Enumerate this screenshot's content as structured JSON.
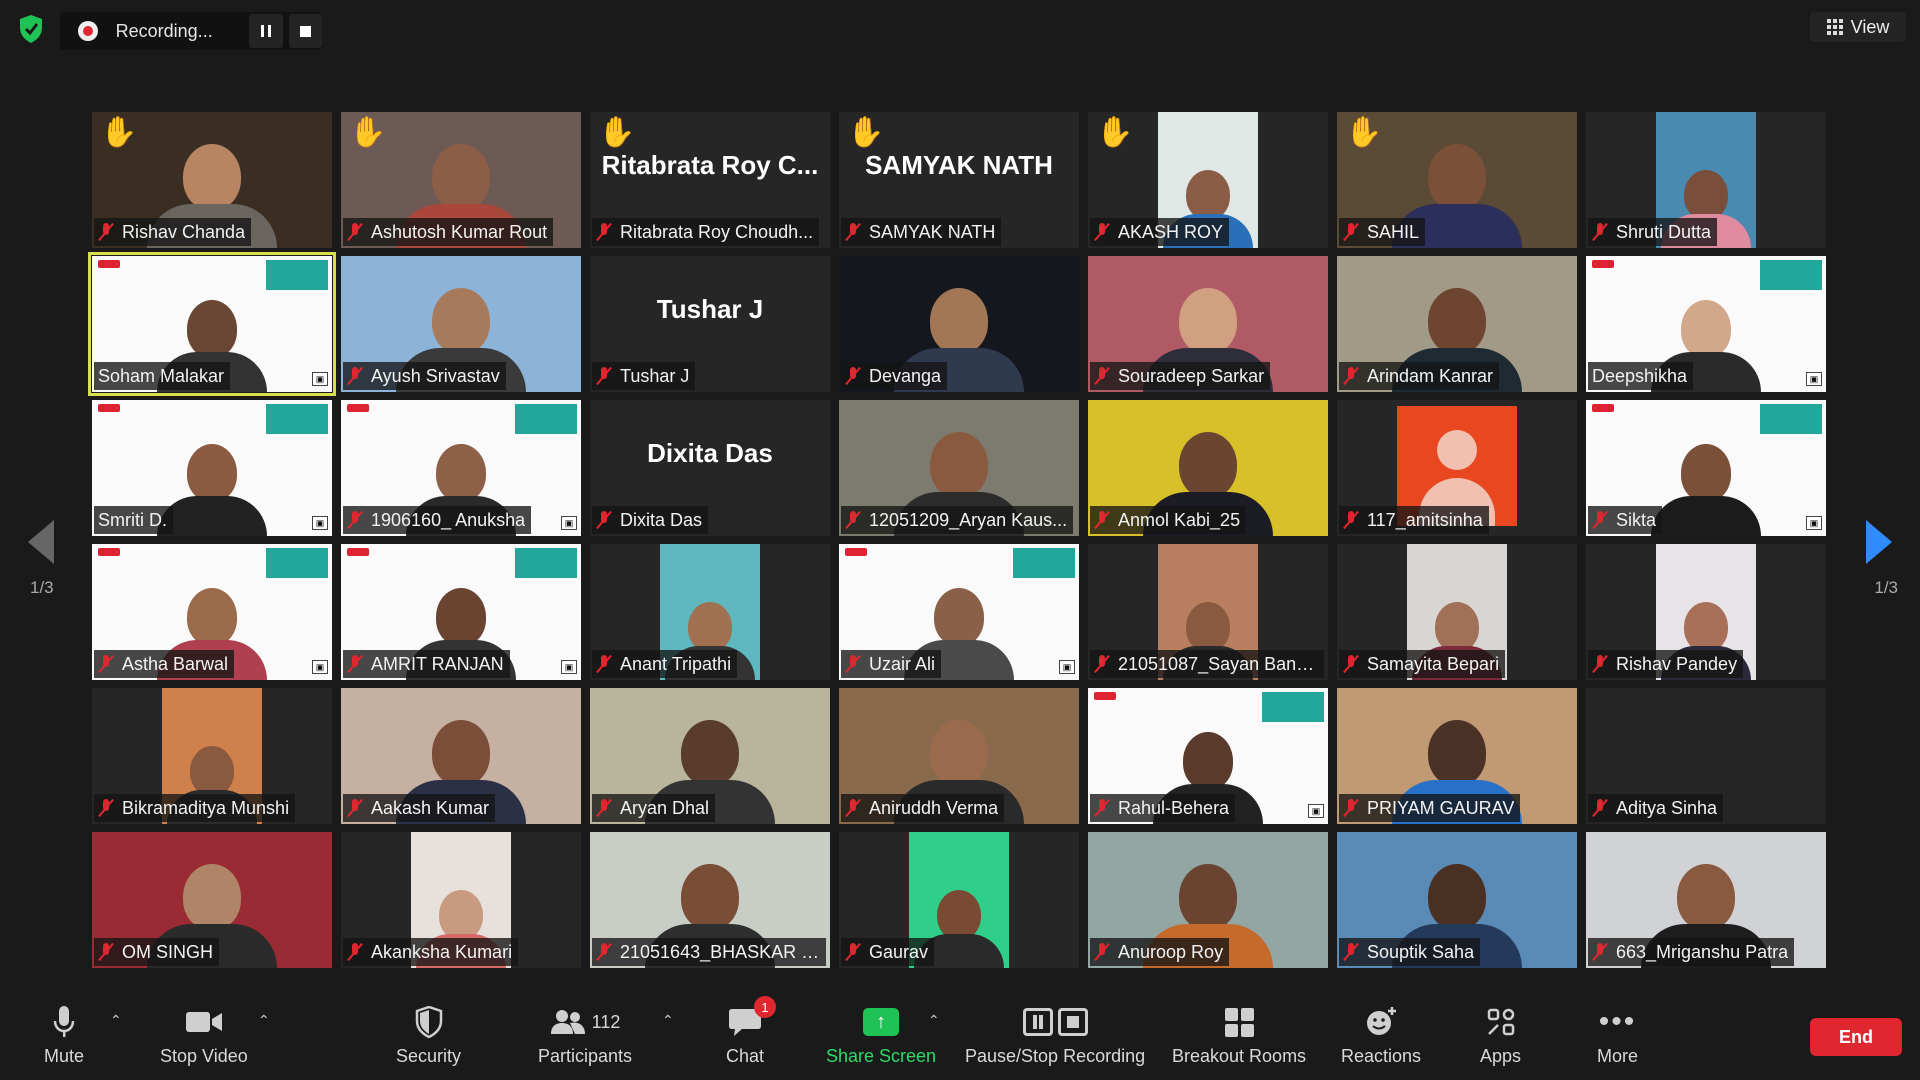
{
  "recording": {
    "status": "Recording..."
  },
  "view_label": "View",
  "page_left": "1/3",
  "page_right": "1/3",
  "participants": [
    {
      "name": "Rishav Chanda",
      "hand": true,
      "video": "person",
      "bg": "#3a2e22",
      "skin": "#b98461",
      "shirt": "#6b6560"
    },
    {
      "name": "Ashutosh Kumar Rout",
      "hand": true,
      "video": "person",
      "bg": "#6e5a55",
      "skin": "#8c5e47",
      "shirt": "#a8473a"
    },
    {
      "name": "Ritabrata Roy Choudh...",
      "display": "Ritabrata Roy C...",
      "hand": true,
      "video": "none"
    },
    {
      "name": "SAMYAK NATH",
      "display": "SAMYAK NATH",
      "hand": true,
      "video": "none"
    },
    {
      "name": "AKASH ROY",
      "hand": true,
      "video": "photo",
      "bg": "#dfe8e4",
      "skin": "#8a5c45",
      "shirt": "#2a70b8"
    },
    {
      "name": "SAHIL",
      "hand": true,
      "video": "person",
      "bg": "#5a4a36",
      "skin": "#7a5138",
      "shirt": "#2b2f5a"
    },
    {
      "name": "Shruti Dutta",
      "hand": false,
      "video": "photo",
      "bg": "#4a8ab0",
      "skin": "#7a4e3a",
      "shirt": "#e08aa0"
    },
    {
      "name": "Soham Malakar",
      "hand": false,
      "video": "slide",
      "active": true,
      "skin": "#6a4634",
      "shirt": "#333333"
    },
    {
      "name": "Ayush Srivastav",
      "hand": false,
      "video": "person",
      "bg": "#8cb4d8",
      "skin": "#a87a5c",
      "shirt": "#3a3a3a"
    },
    {
      "name": "Tushar J",
      "display": "Tushar J",
      "hand": false,
      "video": "none"
    },
    {
      "name": "Devanga",
      "hand": false,
      "video": "person",
      "bg": "#14181e",
      "skin": "#a37656",
      "shirt": "#2f3a4f"
    },
    {
      "name": "Souradeep Sarkar",
      "hand": false,
      "video": "person",
      "bg": "#b05a66",
      "skin": "#d0a080",
      "shirt": "#2e2e3a"
    },
    {
      "name": "Arindam Kanrar",
      "hand": false,
      "video": "person",
      "bg": "#a09a86",
      "skin": "#6e4530",
      "shirt": "#1f2a33"
    },
    {
      "name": "Deepshikha",
      "hand": false,
      "video": "slide",
      "skin": "#d2a88a",
      "shirt": "#2a2a2a"
    },
    {
      "name": "Smriti D.",
      "hand": false,
      "video": "slide",
      "skin": "#8a5a42",
      "shirt": "#222222"
    },
    {
      "name": "1906160_ Anuksha",
      "hand": false,
      "video": "slide",
      "skin": "#8e6048",
      "shirt": "#2a2a2a"
    },
    {
      "name": "Dixita Das",
      "display": "Dixita Das",
      "hand": false,
      "video": "none"
    },
    {
      "name": "12051209_Aryan Kaus...",
      "hand": false,
      "video": "person",
      "bg": "#7d7a70",
      "skin": "#8a5a40",
      "shirt": "#2c2c2c"
    },
    {
      "name": "Anmol Kabi_25",
      "hand": false,
      "video": "person",
      "bg": "#d8c02a",
      "skin": "#6a4530",
      "shirt": "#1c1c24"
    },
    {
      "name": "117_amitsinha",
      "hand": false,
      "video": "avatar"
    },
    {
      "name": "Sikta",
      "hand": false,
      "video": "slide",
      "skin": "#7a5038",
      "shirt": "#1c1c1c"
    },
    {
      "name": "Astha Barwal",
      "hand": false,
      "video": "slide",
      "skin": "#9a6a4a",
      "shirt": "#b04050"
    },
    {
      "name": "AMRIT RANJAN",
      "hand": false,
      "video": "slide",
      "skin": "#6a4430",
      "shirt": "#333"
    },
    {
      "name": "Anant Tripathi",
      "hand": false,
      "video": "photo",
      "bg": "#5fb8c0",
      "skin": "#a07050",
      "shirt": "#333"
    },
    {
      "name": "Uzair Ali",
      "hand": false,
      "video": "slide",
      "skin": "#8a6048",
      "shirt": "#4a4a4a"
    },
    {
      "name": "21051087_Sayan Bane...",
      "hand": false,
      "video": "photo",
      "bg": "#b88060",
      "skin": "#8a5a40",
      "shirt": "#2a2a2a"
    },
    {
      "name": "Samayita Bepari",
      "hand": false,
      "video": "photo",
      "bg": "#d8d6d2",
      "skin": "#a07058",
      "shirt": "#7a2a3a"
    },
    {
      "name": "Rishav Pandey",
      "hand": false,
      "video": "photo",
      "bg": "#e6e4e6",
      "skin": "#a87058",
      "shirt": "#2a2a3a"
    },
    {
      "name": "Bikramaditya Munshi",
      "hand": false,
      "video": "photo",
      "bg": "#d0804a",
      "skin": "#8a5a40",
      "shirt": "#2c2c2c"
    },
    {
      "name": "Aakash Kumar",
      "hand": false,
      "video": "person",
      "bg": "#c6b0a2",
      "skin": "#7a4e38",
      "shirt": "#2c3046"
    },
    {
      "name": "Aryan Dhal",
      "hand": false,
      "video": "person",
      "bg": "#b9b49c",
      "skin": "#5a3c2c",
      "shirt": "#333"
    },
    {
      "name": "Aniruddh Verma",
      "hand": false,
      "video": "person",
      "bg": "#8a6a4c",
      "skin": "#9a6a4c",
      "shirt": "#2a2a2a"
    },
    {
      "name": "Rahul-Behera",
      "hand": false,
      "video": "slide",
      "skin": "#5a3a2a",
      "shirt": "#222"
    },
    {
      "name": "PRIYAM GAURAV",
      "hand": false,
      "video": "person",
      "bg": "#c09a72",
      "skin": "#4a3226",
      "shirt": "#2870c8"
    },
    {
      "name": "Aditya Sinha",
      "hand": false,
      "video": "none",
      "display": ""
    },
    {
      "name": "OM SINGH",
      "hand": false,
      "video": "person",
      "bg": "#9a2a34",
      "skin": "#b08468",
      "shirt": "#2a2a2a"
    },
    {
      "name": "Akanksha Kumari",
      "hand": false,
      "video": "photo",
      "bg": "#e8e0da",
      "skin": "#c89a80",
      "shirt": "#d86a6a"
    },
    {
      "name": "21051643_BHASKAR M...",
      "hand": false,
      "video": "person",
      "bg": "#c8cec6",
      "skin": "#7a4e36",
      "shirt": "#2e2e2e"
    },
    {
      "name": "Gaurav",
      "hand": false,
      "video": "photo",
      "bg": "#2fcf8a",
      "skin": "#7a4a34",
      "shirt": "#2a2a2a"
    },
    {
      "name": "Anuroop Roy",
      "hand": false,
      "video": "person",
      "bg": "#92a6a4",
      "skin": "#6a4430",
      "shirt": "#c46a2a"
    },
    {
      "name": "Souptik Saha",
      "hand": false,
      "video": "person",
      "bg": "#5a8ab6",
      "skin": "#4a3022",
      "shirt": "#243a5a"
    },
    {
      "name": "663_Mriganshu Patra",
      "hand": false,
      "video": "person",
      "bg": "#d0d2d6",
      "skin": "#8a5a40",
      "shirt": "#1e1e1e"
    }
  ],
  "toolbar": {
    "mute": "Mute",
    "stop_video": "Stop Video",
    "security": "Security",
    "participants": "Participants",
    "participants_count": "112",
    "chat": "Chat",
    "chat_badge": "1",
    "share_screen": "Share Screen",
    "pause_stop": "Pause/Stop Recording",
    "breakout": "Breakout Rooms",
    "reactions": "Reactions",
    "apps": "Apps",
    "more": "More",
    "end": "End"
  },
  "colors": {
    "accent_blue": "#2d8cff",
    "end_red": "#e0262e",
    "share_green": "#1fc254",
    "active_border": "#d8e04b"
  }
}
